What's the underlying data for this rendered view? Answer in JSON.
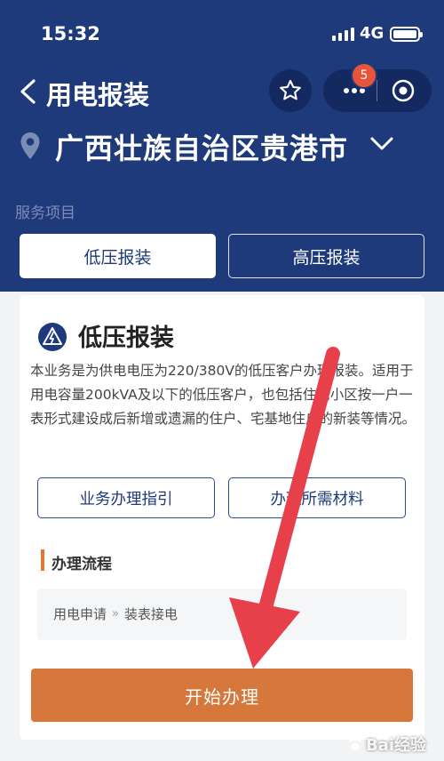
{
  "status_bar": {
    "time": "15:32",
    "network": "4G"
  },
  "nav": {
    "title": "用电报装",
    "badge_count": "5"
  },
  "location": {
    "city": "广西壮族自治区贵港市"
  },
  "services": {
    "label": "服务项目",
    "tabs": [
      {
        "label": "低压报装",
        "selected": true
      },
      {
        "label": "高压报装",
        "selected": false
      }
    ]
  },
  "card": {
    "title": "低压报装",
    "description": "本业务是为供电电压为220/380V的低压客户办理报装。适用于用电容量200kVA及以下的低压客户，也包括住宅小区按一户一表形式建设成后新增或遗漏的住户、宅基地住户的新装等情况。",
    "guide_button": "业务办理指引",
    "materials_button": "办理所需材料",
    "flow_title": "办理流程",
    "flow_steps": [
      "用电申请",
      "装表接电"
    ],
    "start_button": "开始办理"
  },
  "watermark": "Bai经验",
  "colors": {
    "header": "#1e3a7b",
    "accent": "#d6773b",
    "arrow": "#e8404a"
  }
}
